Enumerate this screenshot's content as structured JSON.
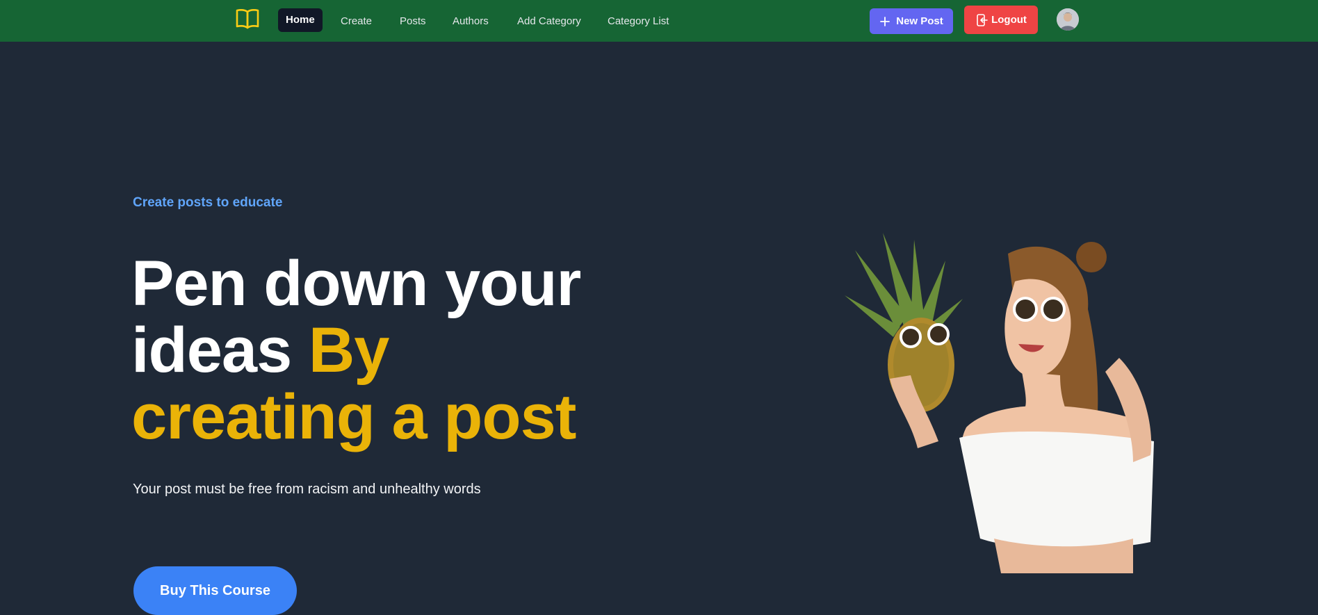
{
  "nav": {
    "items": [
      {
        "label": "Home",
        "active": true
      },
      {
        "label": "Create"
      },
      {
        "label": "Posts"
      },
      {
        "label": "Authors"
      },
      {
        "label": "Add Category"
      },
      {
        "label": "Category List"
      }
    ],
    "new_post_label": "New Post",
    "logout_label": "Logout",
    "logo_icon": "open-book-icon",
    "colors": {
      "bar": "#166534",
      "new_post": "#6366f1",
      "logout": "#ef4444",
      "logo": "#facc15"
    }
  },
  "hero": {
    "eyebrow": "Create posts to educate",
    "headline_line1": "Pen down your",
    "headline_line2_white": "ideas ",
    "headline_line2_gold": "By",
    "headline_line3_gold": "creating a post",
    "subtext": "Your post must be free from racism and unhealthy words",
    "cta_label": "Buy This Course",
    "colors": {
      "background": "#1f2937",
      "accent_gold": "#eab308",
      "eyebrow": "#60a5fa",
      "cta": "#3b82f6"
    }
  }
}
